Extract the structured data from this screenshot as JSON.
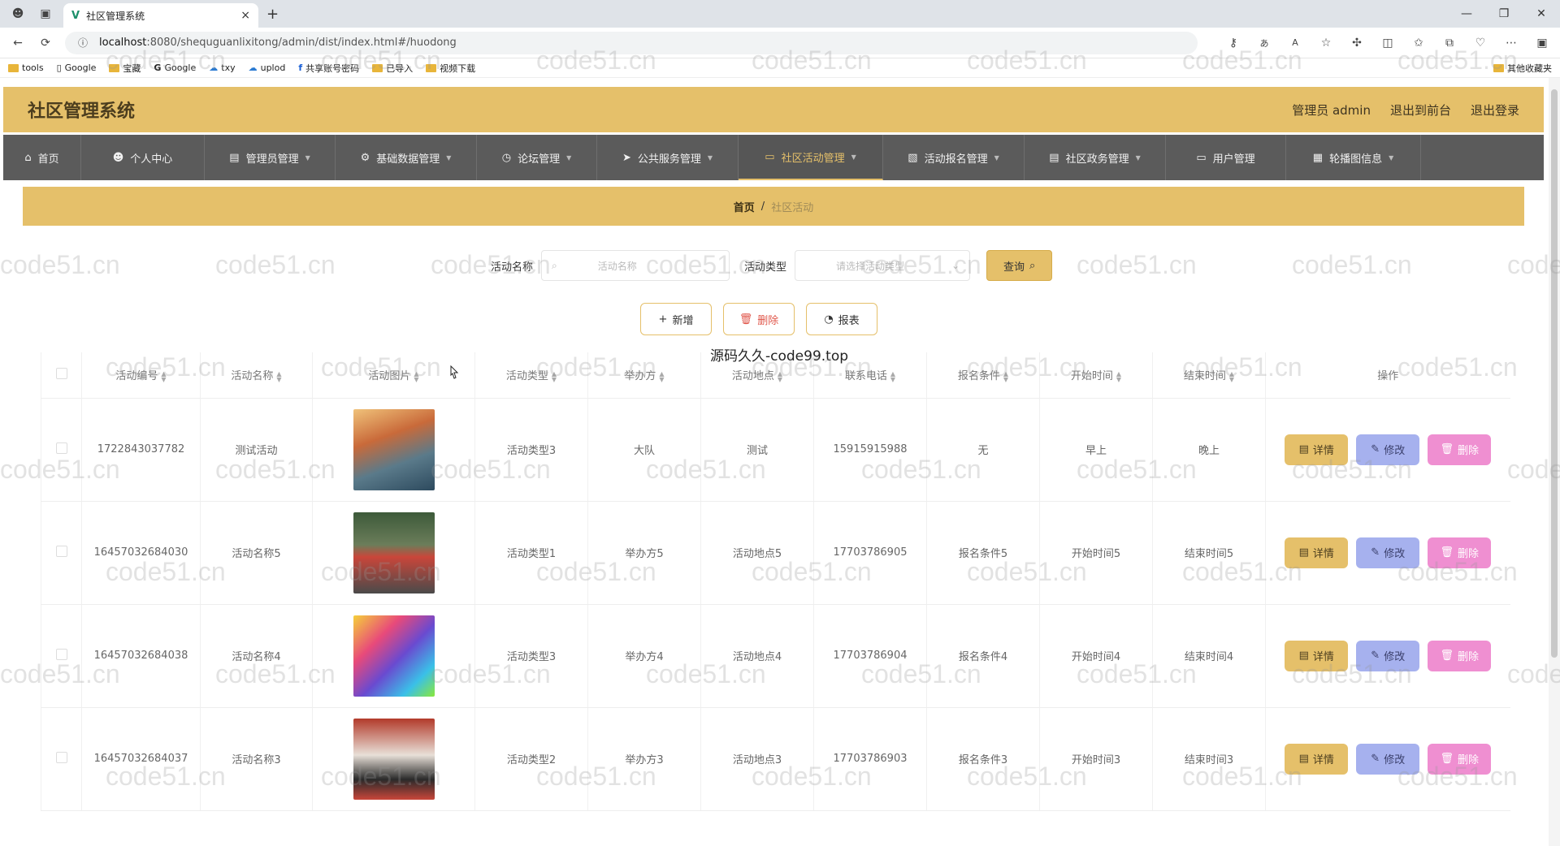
{
  "browser": {
    "tab_title": "社区管理系统",
    "url_host": "localhost",
    "url_path": ":8080/shequguanlixitong/admin/dist/index.html#/huodong",
    "bookmarks": [
      "tools",
      "Google",
      "宝藏",
      "Google",
      "txy",
      "uplod",
      "共享账号密码",
      "已导入",
      "视频下载"
    ],
    "bookmarks_right": "其他收藏夹"
  },
  "header": {
    "title": "社区管理系统",
    "user": "管理员 admin",
    "to_front": "退出到前台",
    "logout": "退出登录"
  },
  "nav": [
    {
      "label": "首页",
      "icon": "home-icon",
      "caret": false
    },
    {
      "label": "个人中心",
      "icon": "user-icon",
      "caret": false
    },
    {
      "label": "管理员管理",
      "icon": "doc-icon",
      "caret": true
    },
    {
      "label": "基础数据管理",
      "icon": "gear-icon",
      "caret": true
    },
    {
      "label": "论坛管理",
      "icon": "clock-icon",
      "caret": true
    },
    {
      "label": "公共服务管理",
      "icon": "send-icon",
      "caret": true
    },
    {
      "label": "社区活动管理",
      "icon": "monitor-icon",
      "caret": true,
      "active": true
    },
    {
      "label": "活动报名管理",
      "icon": "clipboard-icon",
      "caret": true
    },
    {
      "label": "社区政务管理",
      "icon": "doc-icon",
      "caret": true
    },
    {
      "label": "用户管理",
      "icon": "monitor-icon",
      "caret": false
    },
    {
      "label": "轮播图信息",
      "icon": "image-icon",
      "caret": true
    }
  ],
  "breadcrumb": {
    "home": "首页",
    "sep": "/",
    "current": "社区活动"
  },
  "search": {
    "name_label": "活动名称",
    "name_placeholder": "活动名称",
    "type_label": "活动类型",
    "type_placeholder": "请选择活动类型",
    "query_label": "查询"
  },
  "actions": {
    "add": "新增",
    "delete": "删除",
    "report": "报表"
  },
  "table": {
    "headers": [
      "活动编号",
      "活动名称",
      "活动图片",
      "活动类型",
      "举办方",
      "活动地点",
      "联系电话",
      "报名条件",
      "开始时间",
      "结束时间",
      "操作"
    ],
    "rows": [
      [
        "1722843037782",
        "测试活动",
        "",
        "活动类型3",
        "大队",
        "测试",
        "15915915988",
        "无",
        "早上",
        "晚上"
      ],
      [
        "16457032684030",
        "活动名称5",
        "",
        "活动类型1",
        "举办方5",
        "活动地点5",
        "17703786905",
        "报名条件5",
        "开始时间5",
        "结束时间5"
      ],
      [
        "16457032684038",
        "活动名称4",
        "",
        "活动类型3",
        "举办方4",
        "活动地点4",
        "17703786904",
        "报名条件4",
        "开始时间4",
        "结束时间4"
      ],
      [
        "16457032684037",
        "活动名称3",
        "",
        "活动类型2",
        "举办方3",
        "活动地点3",
        "17703786903",
        "报名条件3",
        "开始时间3",
        "结束时间3"
      ]
    ],
    "row_buttons": {
      "detail": "详情",
      "edit": "修改",
      "remove": "删除"
    }
  },
  "overlay_text": "源码久久-code99.top",
  "watermark": "code51.cn",
  "colors": {
    "accent": "#e5c06a",
    "nav_bg": "#5b5b5b",
    "edit": "#a6b1ee",
    "remove": "#ef8fd1"
  }
}
